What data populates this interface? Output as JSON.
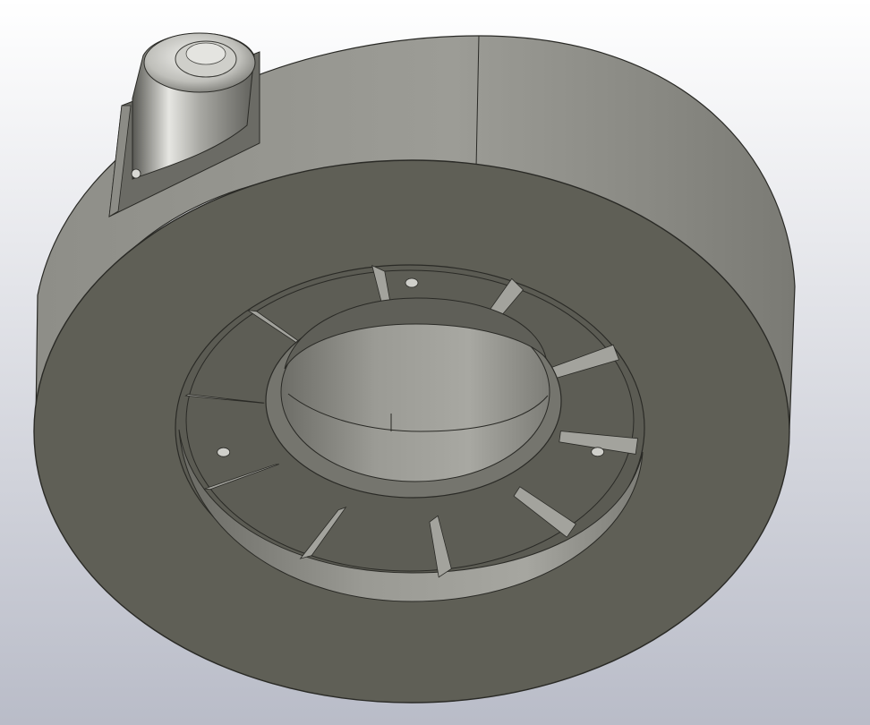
{
  "viewport": {
    "name": "3d-model-viewport",
    "background": {
      "top": "#ffffff",
      "bottom": "#b9bcc8"
    }
  },
  "model": {
    "kind": "cylindrical-housing-with-motor",
    "colors": {
      "face": "#5f5f56",
      "face_dark": "#55554d",
      "side_light": "#a3a39d",
      "side_mid": "#8e8e88",
      "side_dark": "#6f6f69",
      "edge": "#2a2a26",
      "metal_light": "#e6e6e2",
      "metal_mid": "#a9a9a4",
      "metal_dark": "#575752"
    },
    "rib_count": 10,
    "screw_hole_count": 3
  }
}
